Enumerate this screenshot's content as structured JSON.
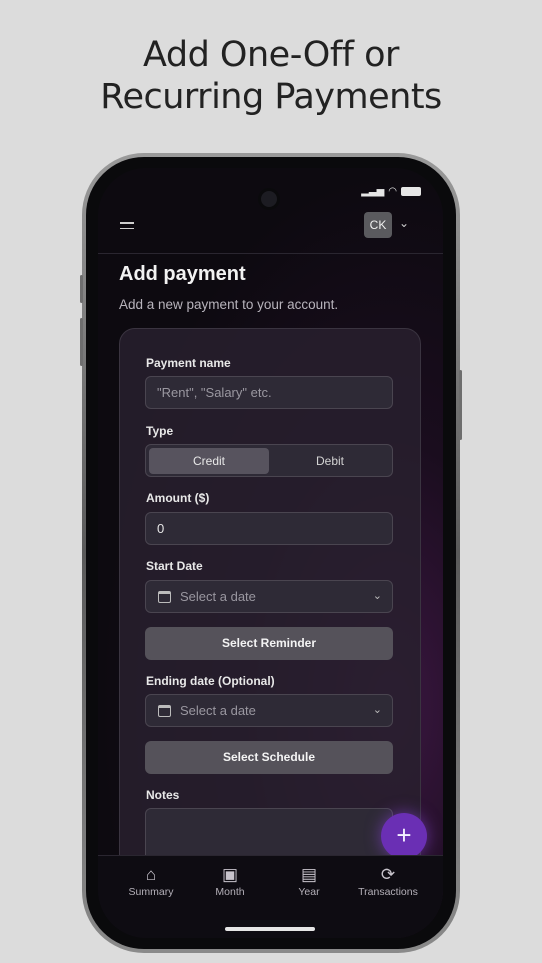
{
  "headline": {
    "line1": "Add One-Off or",
    "line2": "Recurring Payments"
  },
  "topbar": {
    "avatar_initials": "CK",
    "menu_icon": "hamburger-icon",
    "account_chevron": "chevron-down-icon"
  },
  "page": {
    "title": "Add payment",
    "subtitle": "Add a new payment to your account."
  },
  "form": {
    "payment_name": {
      "label": "Payment name",
      "placeholder": "\"Rent\", \"Salary\" etc."
    },
    "type": {
      "label": "Type",
      "options": [
        "Credit",
        "Debit"
      ],
      "selected": "Credit"
    },
    "amount": {
      "label": "Amount ($)",
      "value": "0"
    },
    "start_date": {
      "label": "Start Date",
      "placeholder": "Select a date"
    },
    "reminder_button": "Select Reminder",
    "ending_date": {
      "label": "Ending date (Optional)",
      "placeholder": "Select a date"
    },
    "schedule_button": "Select Schedule",
    "notes": {
      "label": "Notes"
    }
  },
  "fab": {
    "icon": "plus-icon",
    "symbol": "+"
  },
  "nav": [
    {
      "label": "Summary",
      "icon": "home-icon"
    },
    {
      "label": "Month",
      "icon": "month-icon"
    },
    {
      "label": "Year",
      "icon": "calendar-icon"
    },
    {
      "label": "Transactions",
      "icon": "refresh-icon"
    }
  ],
  "colors": {
    "accent": "#6a2fb4",
    "background": "#dcdcdc",
    "card": "#28202e"
  }
}
